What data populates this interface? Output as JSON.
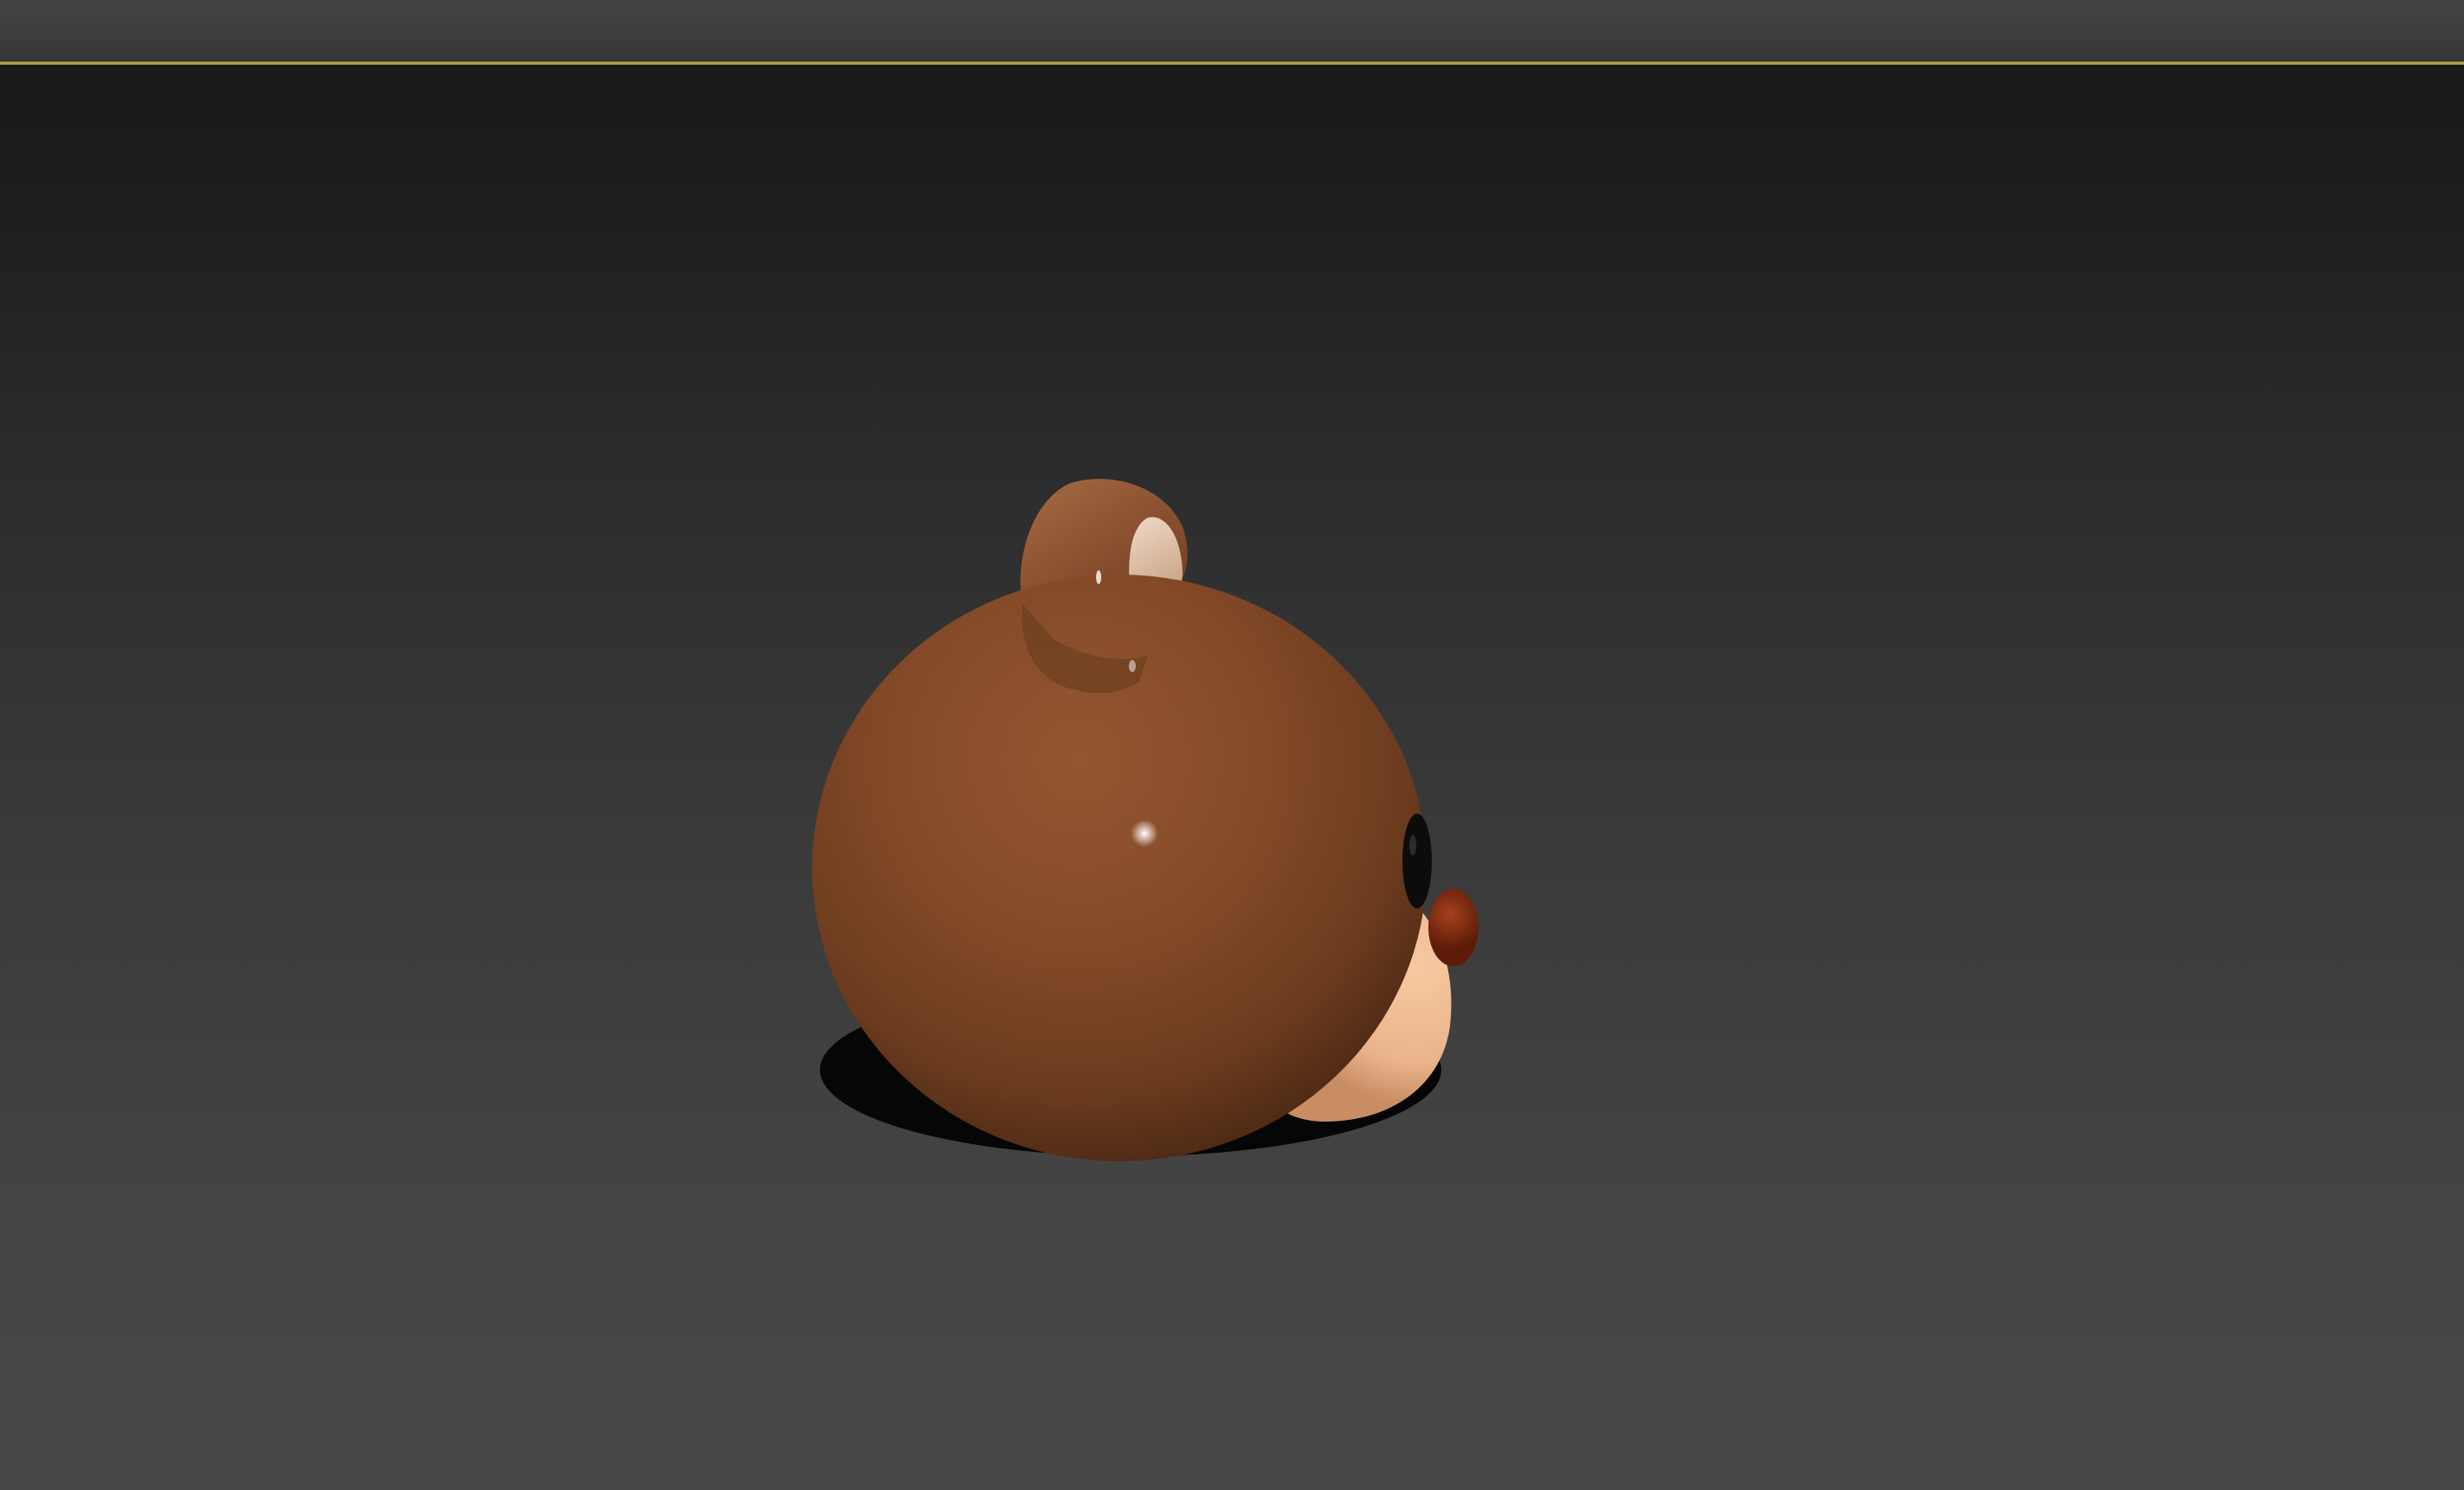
{
  "app": {
    "title": ""
  },
  "viewport": {
    "label": "",
    "background_top": "#191919",
    "background_bottom": "#474747",
    "active_border_color": "#b3a13a"
  },
  "scene": {
    "object_name": "",
    "materials": {
      "fur": "#7b4424",
      "inner_ear": "#e2c2a6",
      "muzzle": "#f2c49a",
      "nose": "#8a2d12",
      "eye": "#0c0c0c"
    }
  }
}
